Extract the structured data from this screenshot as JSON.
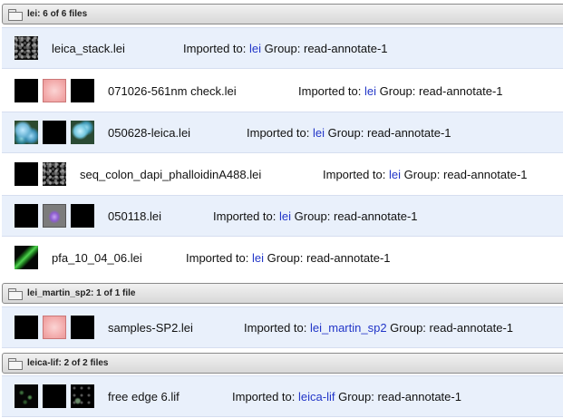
{
  "groups": [
    {
      "title": "lei: 6 of 6 files",
      "rows": [
        {
          "file": "leica_stack.lei",
          "imported_label": "Imported to:",
          "target": "lei",
          "group": "Group: read-annotate-1"
        },
        {
          "file": "071026-561nm check.lei",
          "imported_label": "Imported to:",
          "target": "lei",
          "group": "Group: read-annotate-1"
        },
        {
          "file": "050628-leica.lei",
          "imported_label": "Imported to:",
          "target": "lei",
          "group": "Group: read-annotate-1"
        },
        {
          "file": "seq_colon_dapi_phalloidinA488.lei",
          "imported_label": "Imported to:",
          "target": "lei",
          "group": "Group: read-annotate-1"
        },
        {
          "file": "050118.lei",
          "imported_label": "Imported to:",
          "target": "lei",
          "group": "Group: read-annotate-1"
        },
        {
          "file": "pfa_10_04_06.lei",
          "imported_label": "Imported to:",
          "target": "lei",
          "group": "Group: read-annotate-1"
        }
      ]
    },
    {
      "title": "lei_martin_sp2: 1 of 1 file",
      "rows": [
        {
          "file": "samples-SP2.lei",
          "imported_label": "Imported to:",
          "target": "lei_martin_sp2",
          "group": "Group: read-annotate-1"
        }
      ]
    },
    {
      "title": "leica-lif: 2 of 2 files",
      "rows": [
        {
          "file": "free edge 6.lif",
          "imported_label": "Imported to:",
          "target": "leica-lif",
          "group": "Group: read-annotate-1"
        }
      ]
    }
  ],
  "icons": {
    "group_header": "folder-icon",
    "thumbnail": "image-thumbnail-icon"
  },
  "colors": {
    "link_blue": "#2236c8",
    "row_highlight": "#e9f0fb"
  }
}
